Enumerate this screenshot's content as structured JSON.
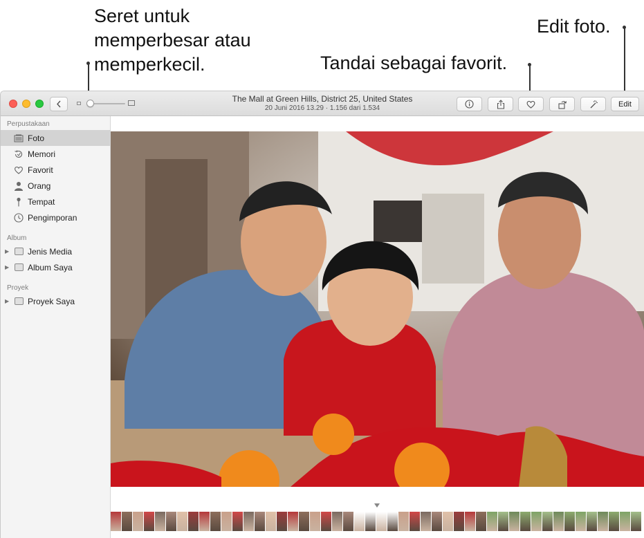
{
  "callouts": {
    "zoom_lines": [
      "Seret untuk",
      "memperbesar atau",
      "memperkecil."
    ],
    "favorite": "Tandai sebagai favorit.",
    "edit": "Edit foto."
  },
  "window": {
    "title": "The Mall at Green Hills, District 25, United States",
    "subtitle": "20 Juni 2016 13.29 · 1.156 dari 1.534",
    "toolbar": {
      "back_icon": "chevron-left-icon",
      "info_icon": "info-icon",
      "share_icon": "share-icon",
      "favorite_icon": "heart-icon",
      "rotate_icon": "rotate-icon",
      "enhance_icon": "magic-wand-icon",
      "edit_label": "Edit"
    }
  },
  "sidebar": {
    "library_header": "Perpustakaan",
    "library": [
      {
        "label": "Foto",
        "icon": "photos-icon",
        "selected": true
      },
      {
        "label": "Memori",
        "icon": "memories-icon"
      },
      {
        "label": "Favorit",
        "icon": "heart-icon"
      },
      {
        "label": "Orang",
        "icon": "person-icon"
      },
      {
        "label": "Tempat",
        "icon": "pin-icon"
      },
      {
        "label": "Pengimporan",
        "icon": "clock-icon"
      }
    ],
    "album_header": "Album",
    "albums": [
      {
        "label": "Jenis Media",
        "icon": "folder-icon"
      },
      {
        "label": "Album Saya",
        "icon": "folder-icon"
      }
    ],
    "project_header": "Proyek",
    "projects": [
      {
        "label": "Proyek Saya",
        "icon": "folder-icon"
      }
    ]
  },
  "colors": {
    "sidebar_bg": "#f4f4f4",
    "selection": "#d3d3d3",
    "accent_red": "#c8161d"
  }
}
